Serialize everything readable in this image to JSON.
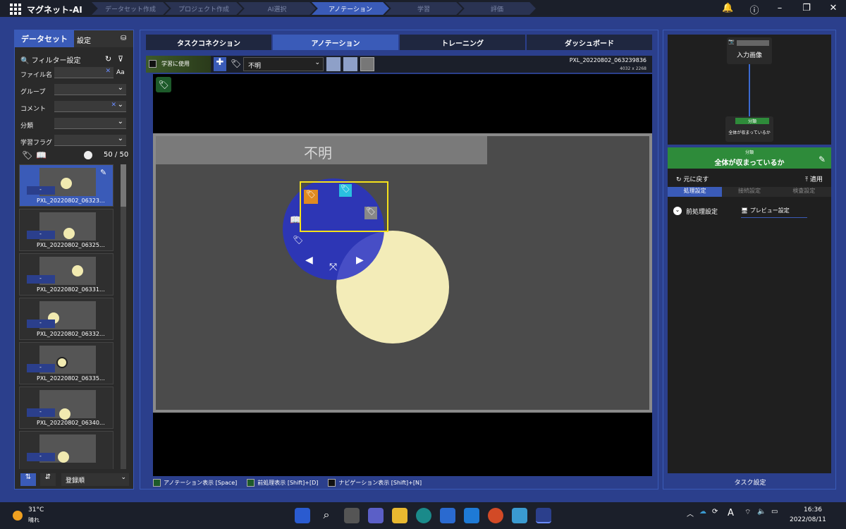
{
  "app": {
    "title": "マグネット-AI"
  },
  "steps": [
    "データセット作成",
    "プロジェクト作成",
    "AI選択",
    "アノテーション",
    "学習",
    "評価"
  ],
  "active_step": 3,
  "left_panel": {
    "tab_dataset": "データセット",
    "tab_settings": "設定",
    "filter_title": "フィルター設定",
    "fields": {
      "filename": "ファイル名",
      "group": "グループ",
      "comment": "コメント",
      "classification": "分類",
      "learn_flag": "学習フラグ"
    },
    "aa": "Aa",
    "count": "50 / 50",
    "thumbnails": [
      {
        "label": "PXL_20220802_06323…",
        "tag": "-",
        "selected": true
      },
      {
        "label": "PXL_20220802_06325…",
        "tag": "-",
        "selected": false
      },
      {
        "label": "PXL_20220802_06331…",
        "tag": "-",
        "selected": false
      },
      {
        "label": "PXL_20220802_06332…",
        "tag": "-",
        "selected": false
      },
      {
        "label": "PXL_20220802_06335…",
        "tag": "-",
        "selected": false
      },
      {
        "label": "PXL_20220802_06340…",
        "tag": "-",
        "selected": false
      },
      {
        "label": "",
        "tag": "-",
        "selected": false
      }
    ],
    "sort_value": "登録順"
  },
  "center": {
    "tabs": [
      "タスクコネクション",
      "アノテーション",
      "トレーニング",
      "ダッシュボード"
    ],
    "active_tab": 1,
    "use_for_learning": "学習に使用",
    "class_select": "不明",
    "file_name": "PXL_20220802_063239836",
    "resolution": "4032 x 2268",
    "image_label": "不明",
    "bottom": {
      "annotation_display": "アノテーション表示 [Space]",
      "preprocess_display": "前処理表示 [Shift]+[D]",
      "navigation_display": "ナビゲーション表示 [Shift]+[N]"
    }
  },
  "right_panel": {
    "node_input": "入力画像",
    "node_class_tag": "分類",
    "node_class_text": "全体が収まっているか",
    "header_small": "分類",
    "header_title": "全体が収まっているか",
    "undo": "元に戻す",
    "apply": "適用",
    "tabs": [
      "処理設定",
      "接続設定",
      "検査設定"
    ],
    "preprocess": "前処理設定",
    "preview": "プレビュー設定",
    "task_settings": "タスク設定"
  },
  "taskbar": {
    "weather_temp": "31°C",
    "weather_desc": "晴れ",
    "time": "16:36",
    "date": "2022/08/11",
    "ime": "A"
  }
}
